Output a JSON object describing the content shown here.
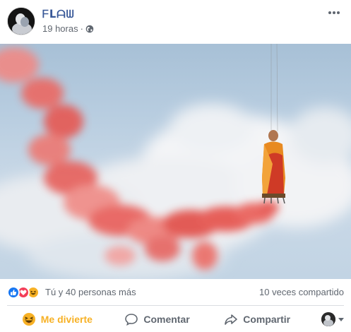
{
  "post": {
    "author": "ᖴᒪᗩᗯ",
    "time": "19 horas",
    "separator": "·",
    "privacy_icon": "globe-icon",
    "more_icon": "more-dots-icon"
  },
  "photo": {
    "icon": "photo-monk-levitating-red-smoke",
    "colors": {
      "sky": "#b8cde0",
      "cloud": "#f3f4f6",
      "smoke": "#e8534f",
      "robe": "#e07a1c"
    }
  },
  "reactions": {
    "icons": [
      "like-icon",
      "love-icon",
      "haha-icon"
    ],
    "summary": "Tú y 40 personas más",
    "shares": "10 veces compartido"
  },
  "actions": {
    "react_label": "Me divierte",
    "comment_label": "Comentar",
    "share_label": "Compartir",
    "accent": "#f7b125"
  }
}
